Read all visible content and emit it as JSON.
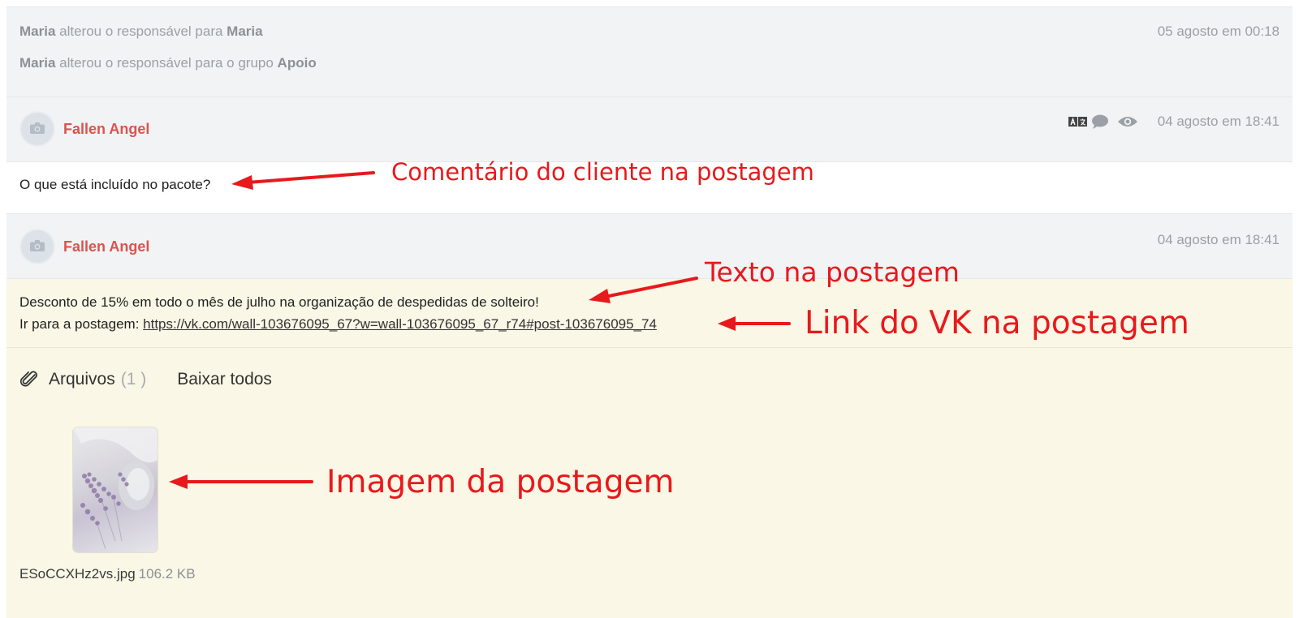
{
  "log": {
    "line1": {
      "actor": "Maria",
      "action": " alterou o responsável para ",
      "target": "Maria"
    },
    "line2": {
      "actor": "Maria",
      "action": " alterou o responsável para o grupo ",
      "target": "Apoio"
    },
    "time": "05 agosto em 00:18"
  },
  "comment": {
    "author": "Fallen Angel",
    "time": "04 agosto em 18:41",
    "text": "O que está incluído no pacote?",
    "icons": [
      "translate-icon",
      "comment-icon",
      "eye-icon"
    ]
  },
  "post": {
    "author": "Fallen Angel",
    "time": "04 agosto em 18:41",
    "text": "Desconto de 15% em todo o mês de julho na organização de despedidas de solteiro!",
    "link_prefix": "Ir para a postagem: ",
    "link": "https://vk.com/wall-103676095_67?w=wall-103676095_67_r74#post-103676095_74"
  },
  "files": {
    "label": "Arquivos",
    "count": "(1 )",
    "download_all": "Baixar todos",
    "items": [
      {
        "name": "ESoCCXHz2vs.jpg",
        "size": "106.2 KB"
      }
    ]
  },
  "annotations": {
    "comment": "Comentário do cliente na postagem",
    "post_text": "Texto na postagem",
    "vk_link": "Link do VK na postagem",
    "image": "Imagem da postagem"
  },
  "colors": {
    "author": "#d9544f",
    "annotation": "#e8191c",
    "post_bg": "#faf7e6",
    "header_bg": "#f2f3f4"
  }
}
